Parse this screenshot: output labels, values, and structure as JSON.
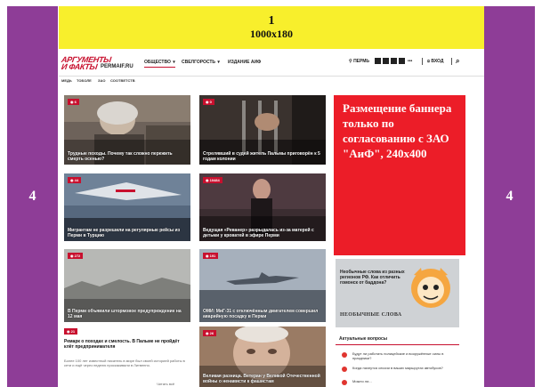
{
  "sides": {
    "left_label": "4",
    "right_label": "4"
  },
  "top_banner": {
    "number": "1",
    "size": "1000x180"
  },
  "logo": {
    "line1": "АРГУМЕНТЫ",
    "line2": "И ФАКТЫ",
    "region": "PERMAIF.RU"
  },
  "nav": [
    {
      "label": "ОБЩЕСТВО",
      "chevron": "▾"
    },
    {
      "label": "СВЕЛГОРОСТЬ",
      "chevron": "▾"
    },
    {
      "label": "ИЗДАНИЕ АИФ",
      "chevron": ""
    }
  ],
  "tools": {
    "city": "ПЕРМЬ",
    "more": "•••",
    "login": "ВХОД",
    "search_icon": "search"
  },
  "subnav": [
    "МЕДЬ",
    "ТОБОЛЕ",
    "ЗАО",
    "СООТВЕТСТВ"
  ],
  "cards": [
    {
      "badge": "6",
      "caption": "Трудные походы. Почему так сложно пережить смерть осенью?"
    },
    {
      "badge": "0",
      "caption": "Стрелявший в судей житель Пальмы приговорён к 5 годам колонии"
    },
    {
      "badge": "44",
      "caption": "Мигрантам не разрешили на регулярные рейсы из Перми в Турцию"
    },
    {
      "badge": "10484",
      "caption": "Ведущая «Реванер» разрыдалась из-за матерей с детьми у кроватей в эфире Перми"
    },
    {
      "badge": "272",
      "caption": "В Перми объявили штормовое предупреждение на 12 мая"
    },
    {
      "badge": "191",
      "caption": "ОМИ: МиГ-31 с отключённым двигателем совершил аварийную посадку в Перми"
    },
    {
      "badge": "26",
      "caption": "Великая разница. Ветеран у Великой Отечественной войны о ненависти к фашистам"
    }
  ],
  "text_card": {
    "badge": "21",
    "title": "Ремарк о походах и смелость. В Пальме не пройдёт клёт предпринимателя",
    "desc": "Более 100 лет известный писатель в мире был своей историей работы в сети и ещё через неделю проскакивали в Литвенно.",
    "more": "Читать всё"
  },
  "red_ad": {
    "text": "Размещение баннера только по согласованию с ЗАО \"АиФ\", 240x400"
  },
  "promo": {
    "title": "Необычные слова из разных регионов РФ. Как отличить гомонск от баддона?",
    "footer": "НЕОБЫЧНЫЕ СЛОВА"
  },
  "questions": {
    "title": "Актуальные вопросы",
    "items": [
      "Будут ли работать полицейские и вооружённые силы в праздники?",
      "Когда начнутся сессии в ваших маршрутах автобусов?",
      "Можно ли..."
    ]
  }
}
